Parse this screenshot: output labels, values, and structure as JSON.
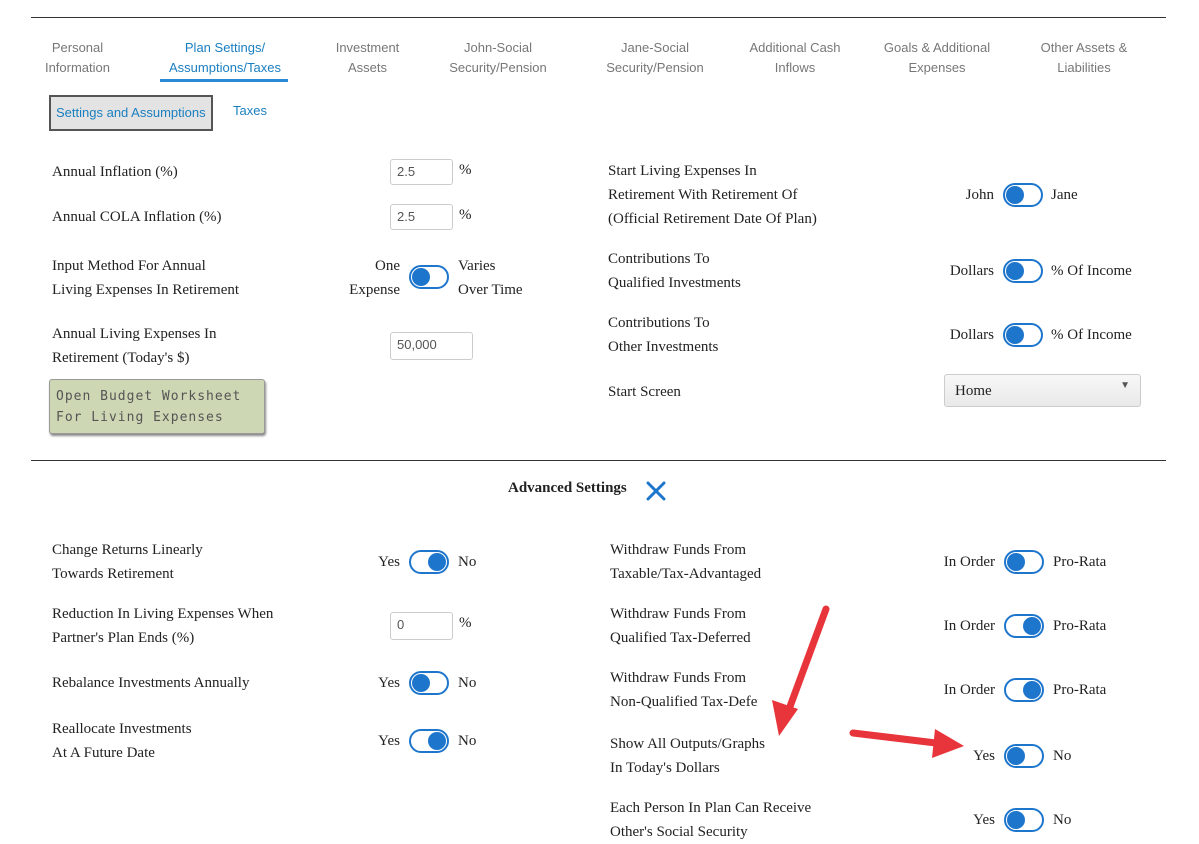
{
  "tabs": [
    {
      "line1": "Personal",
      "line2": "Information"
    },
    {
      "line1": "Plan Settings/",
      "line2": "Assumptions/Taxes"
    },
    {
      "line1": "Investment",
      "line2": "Assets"
    },
    {
      "line1": "John-Social",
      "line2": "Security/Pension"
    },
    {
      "line1": "Jane-Social",
      "line2": "Security/Pension"
    },
    {
      "line1": "Additional Cash",
      "line2": "Inflows"
    },
    {
      "line1": "Goals & Additional",
      "line2": "Expenses"
    },
    {
      "line1": "Other Assets &",
      "line2": "Liabilities"
    }
  ],
  "active_tab": "Plan Settings/ Assumptions/Taxes",
  "subtabs": {
    "settings": "Settings and Assumptions",
    "taxes": "Taxes"
  },
  "settings": {
    "annual_inflation": {
      "label": "Annual Inflation (%)",
      "value": "2.5",
      "unit": "%"
    },
    "annual_cola": {
      "label": "Annual COLA Inflation (%)",
      "value": "2.5",
      "unit": "%"
    },
    "input_method": {
      "label_line1": "Input Method For Annual",
      "label_line2": "Living Expenses In Retirement",
      "left_line1": "One",
      "left_line2": "Expense",
      "right_line1": "Varies",
      "right_line2": "Over Time"
    },
    "annual_living": {
      "label_line1": "Annual Living Expenses In",
      "label_line2": "Retirement (Today's $)",
      "value": "50,000"
    },
    "budget_button": {
      "line1": "Open Budget Worksheet",
      "line2": "For Living Expenses"
    },
    "start_living": {
      "label_line1": "Start Living Expenses In",
      "label_line2": "Retirement With Retirement Of",
      "label_line3": "(Official Retirement Date Of Plan)",
      "left": "John",
      "right": "Jane"
    },
    "contrib_qualified": {
      "label_line1": "Contributions To",
      "label_line2": "Qualified Investments",
      "left": "Dollars",
      "right": "% Of Income"
    },
    "contrib_other": {
      "label_line1": "Contributions To",
      "label_line2": "Other Investments",
      "left": "Dollars",
      "right": "% Of Income"
    },
    "start_screen": {
      "label": "Start Screen",
      "value": "Home",
      "caret": "▼"
    }
  },
  "advanced": {
    "title": "Advanced Settings",
    "close_icon": "×",
    "change_returns": {
      "label_line1": "Change Returns Linearly",
      "label_line2": "Towards Retirement",
      "left": "Yes",
      "right": "No"
    },
    "reduction": {
      "label_line1": "Reduction In Living Expenses When",
      "label_line2": "Partner's Plan Ends (%)",
      "value": "0",
      "unit": "%"
    },
    "rebalance": {
      "label": "Rebalance Investments Annually",
      "left": "Yes",
      "right": "No"
    },
    "reallocate": {
      "label_line1": "Reallocate Investments",
      "label_line2": "At A Future Date",
      "left": "Yes",
      "right": "No"
    },
    "withdraw_taxable": {
      "label_line1": "Withdraw Funds From",
      "label_line2": "Taxable/Tax-Advantaged",
      "left": "In Order",
      "right": "Pro-Rata"
    },
    "withdraw_qualified": {
      "label_line1": "Withdraw Funds From",
      "label_line2": "Qualified Tax-Deferred",
      "left": "In Order",
      "right": "Pro-Rata"
    },
    "withdraw_nonqualified": {
      "label_line1": "Withdraw Funds From",
      "label_line2": "Non-Qualified Tax-Deferre",
      "left": "In Order",
      "right": "Pro-Rata"
    },
    "todays_dollars": {
      "label_line1": "Show All Outputs/Graphs",
      "label_line2": "In Today's Dollars",
      "left": "Yes",
      "right": "No"
    },
    "each_person": {
      "label_line1": "Each Person In Plan Can Receive",
      "label_line2": "Other's Social Security",
      "left": "Yes",
      "right": "No"
    }
  },
  "colors": {
    "accent": "#1d76cc",
    "arrow": "#e8353b",
    "button_bg": "#cdd7b4"
  }
}
